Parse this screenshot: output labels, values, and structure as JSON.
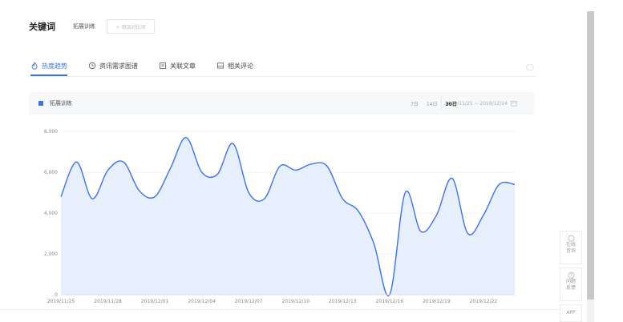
{
  "header": {
    "label": "关键词",
    "tag": "拓展训练",
    "add_placeholder": "+ 添加对比词"
  },
  "tabs": [
    {
      "label": "热度趋势",
      "icon": "flame-icon",
      "active": true
    },
    {
      "label": "资讯需求图谱",
      "icon": "clock-icon",
      "active": false
    },
    {
      "label": "关联文章",
      "icon": "article-icon",
      "active": false
    },
    {
      "label": "相关评论",
      "icon": "comment-icon",
      "active": false
    }
  ],
  "chart_panel": {
    "legend": "拓展训练",
    "ranges": [
      "7日",
      "14日",
      "30日"
    ],
    "selected_range": "30日",
    "date_range": "2019/11/25 ~ 2019/12/24"
  },
  "side_buttons": [
    {
      "label1": "在线",
      "label2": "咨询",
      "icon": "chat-icon"
    },
    {
      "label1": "问题",
      "label2": "反馈",
      "icon": "help-icon"
    },
    {
      "label1": "APP",
      "label2": "",
      "icon": "app-icon"
    }
  ],
  "colors": {
    "accent": "#3a73e8",
    "area": "#e8effc"
  },
  "chart_data": {
    "type": "area",
    "series": [
      {
        "name": "拓展训练",
        "values": [
          4800,
          6500,
          4700,
          6100,
          6500,
          5100,
          4800,
          6200,
          7700,
          6000,
          5900,
          7400,
          5000,
          4700,
          6300,
          6100,
          6400,
          6300,
          4700,
          4100,
          2500,
          0,
          5000,
          3100,
          3900,
          5700,
          3000,
          3900,
          5400,
          5400
        ]
      }
    ],
    "x": [
      "2019/11/25",
      "2019/11/26",
      "2019/11/27",
      "2019/11/28",
      "2019/11/29",
      "2019/11/30",
      "2019/12/01",
      "2019/12/02",
      "2019/12/03",
      "2019/12/04",
      "2019/12/05",
      "2019/12/06",
      "2019/12/07",
      "2019/12/08",
      "2019/12/09",
      "2019/12/10",
      "2019/12/11",
      "2019/12/12",
      "2019/12/13",
      "2019/12/14",
      "2019/12/15",
      "2019/12/16",
      "2019/12/17",
      "2019/12/18",
      "2019/12/19",
      "2019/12/20",
      "2019/12/21",
      "2019/12/22",
      "2019/12/23",
      "2019/12/24"
    ],
    "x_tick_labels": [
      "2019/11/25",
      "2019/11/28",
      "2019/12/01",
      "2019/12/04",
      "2019/12/07",
      "2019/12/10",
      "2019/12/13",
      "2019/12/16",
      "2019/12/19",
      "2019/12/22"
    ],
    "y_ticks": [
      "8,000",
      "6,000",
      "4,000",
      "2,000",
      "0"
    ],
    "ylim": [
      0,
      8000
    ],
    "grid": true
  }
}
